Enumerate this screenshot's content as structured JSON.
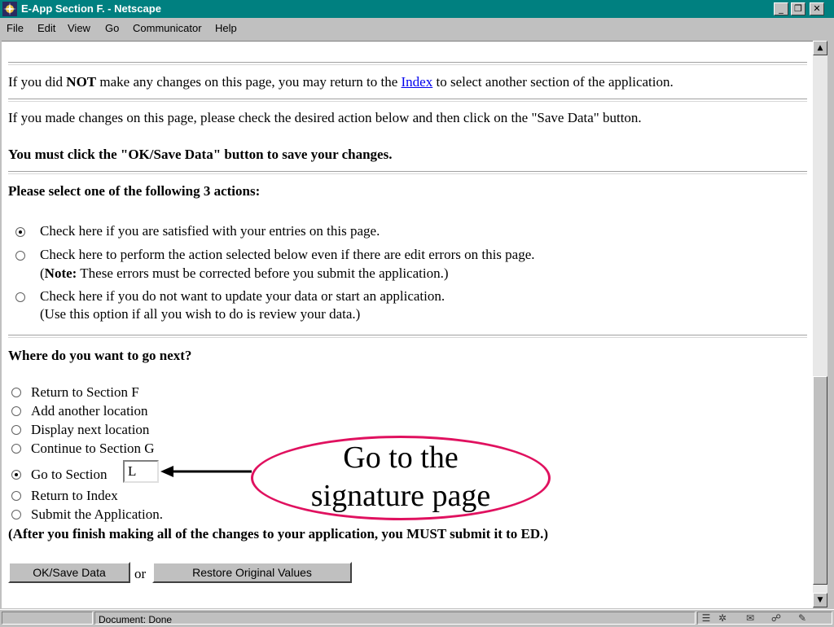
{
  "window": {
    "title": "E-App Section F. - Netscape",
    "controls": {
      "minimize": "_",
      "maximize": "❐",
      "close": "✕"
    }
  },
  "menu": [
    "File",
    "Edit",
    "View",
    "Go",
    "Communicator",
    "Help"
  ],
  "content": {
    "line1": {
      "pre": "If you did",
      "bold": "NOT",
      "mid": "make any changes on this page, you may return to the",
      "link": "Index",
      "post": "to select another section of the application."
    },
    "line2": "If you made changes on this page, please check the desired action below and then click on the \"Save Data\" button.",
    "line3": "You must click the \"OK/Save Data\" button to save your changes.",
    "actions_heading": "Please select one of the following 3 actions:",
    "actions": [
      {
        "label": "Check here if you are satisfied with your entries on this page.",
        "checked": true
      },
      {
        "label": "Check here to perform the action selected below even if there are edit errors on this page.",
        "note_bold": "Note:",
        "note": "These errors must be corrected before you submit the application.",
        "checked": false
      },
      {
        "label": "Check here if you do not want to update your data or start an application.",
        "sub": "(Use this option if all you wish to do is review your data.)",
        "checked": false
      }
    ],
    "next_heading": "Where do you want to go next?",
    "next_options": [
      {
        "label": "Return to Section F",
        "checked": false
      },
      {
        "label": "Add another location",
        "checked": false
      },
      {
        "label": "Display next location",
        "checked": false
      },
      {
        "label": "Continue to Section G",
        "checked": false
      },
      {
        "label": "Go to Section",
        "checked": true
      },
      {
        "label": "Return to Index",
        "checked": false
      },
      {
        "label": "Submit the Application.",
        "checked": false
      }
    ],
    "go_to_section_value": "L",
    "submit_note": "(After you finish making all of the changes to your application, you MUST submit it to ED.)",
    "ok_button": "OK/Save Data",
    "or_text": "or",
    "restore_button": "Restore Original Values"
  },
  "annotation": {
    "line1": "Go to the",
    "line2": "signature page",
    "color": "#e0115f"
  },
  "status": {
    "text": "Document: Done"
  }
}
